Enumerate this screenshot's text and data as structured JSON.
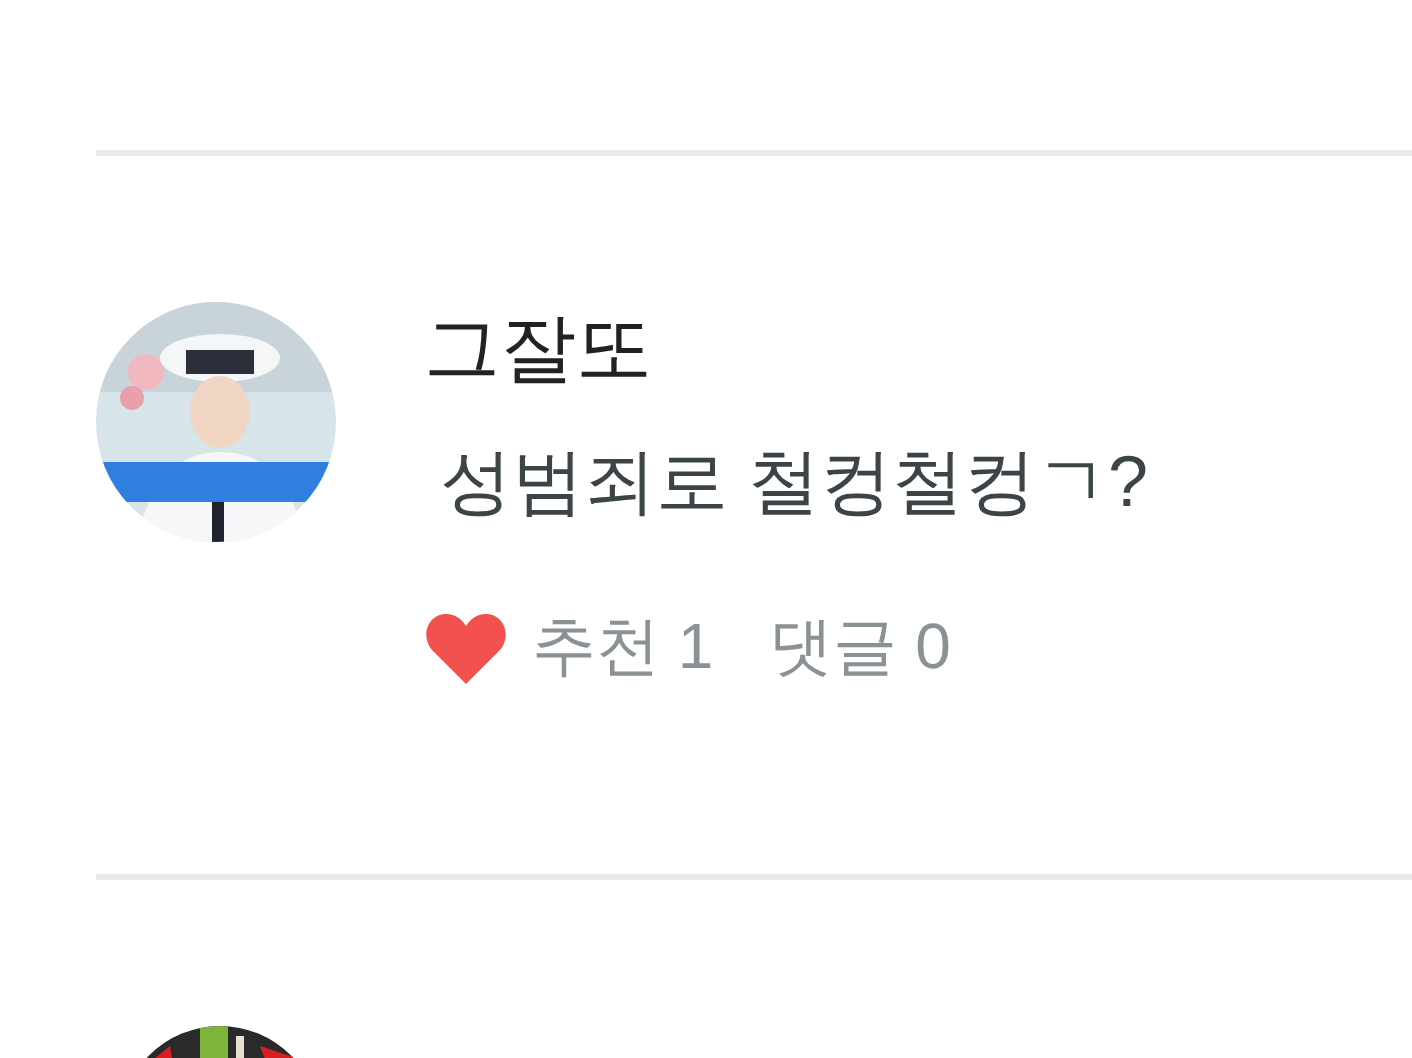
{
  "comments": [
    {
      "author": "그잘또",
      "text": "성범죄로 철컹철컹ㄱ?",
      "liked": true,
      "likes": "추천 1",
      "replies": "댓글 0",
      "avatar": {
        "kind": "picture"
      }
    },
    {
      "avatar": {
        "kind": "picture"
      }
    }
  ]
}
